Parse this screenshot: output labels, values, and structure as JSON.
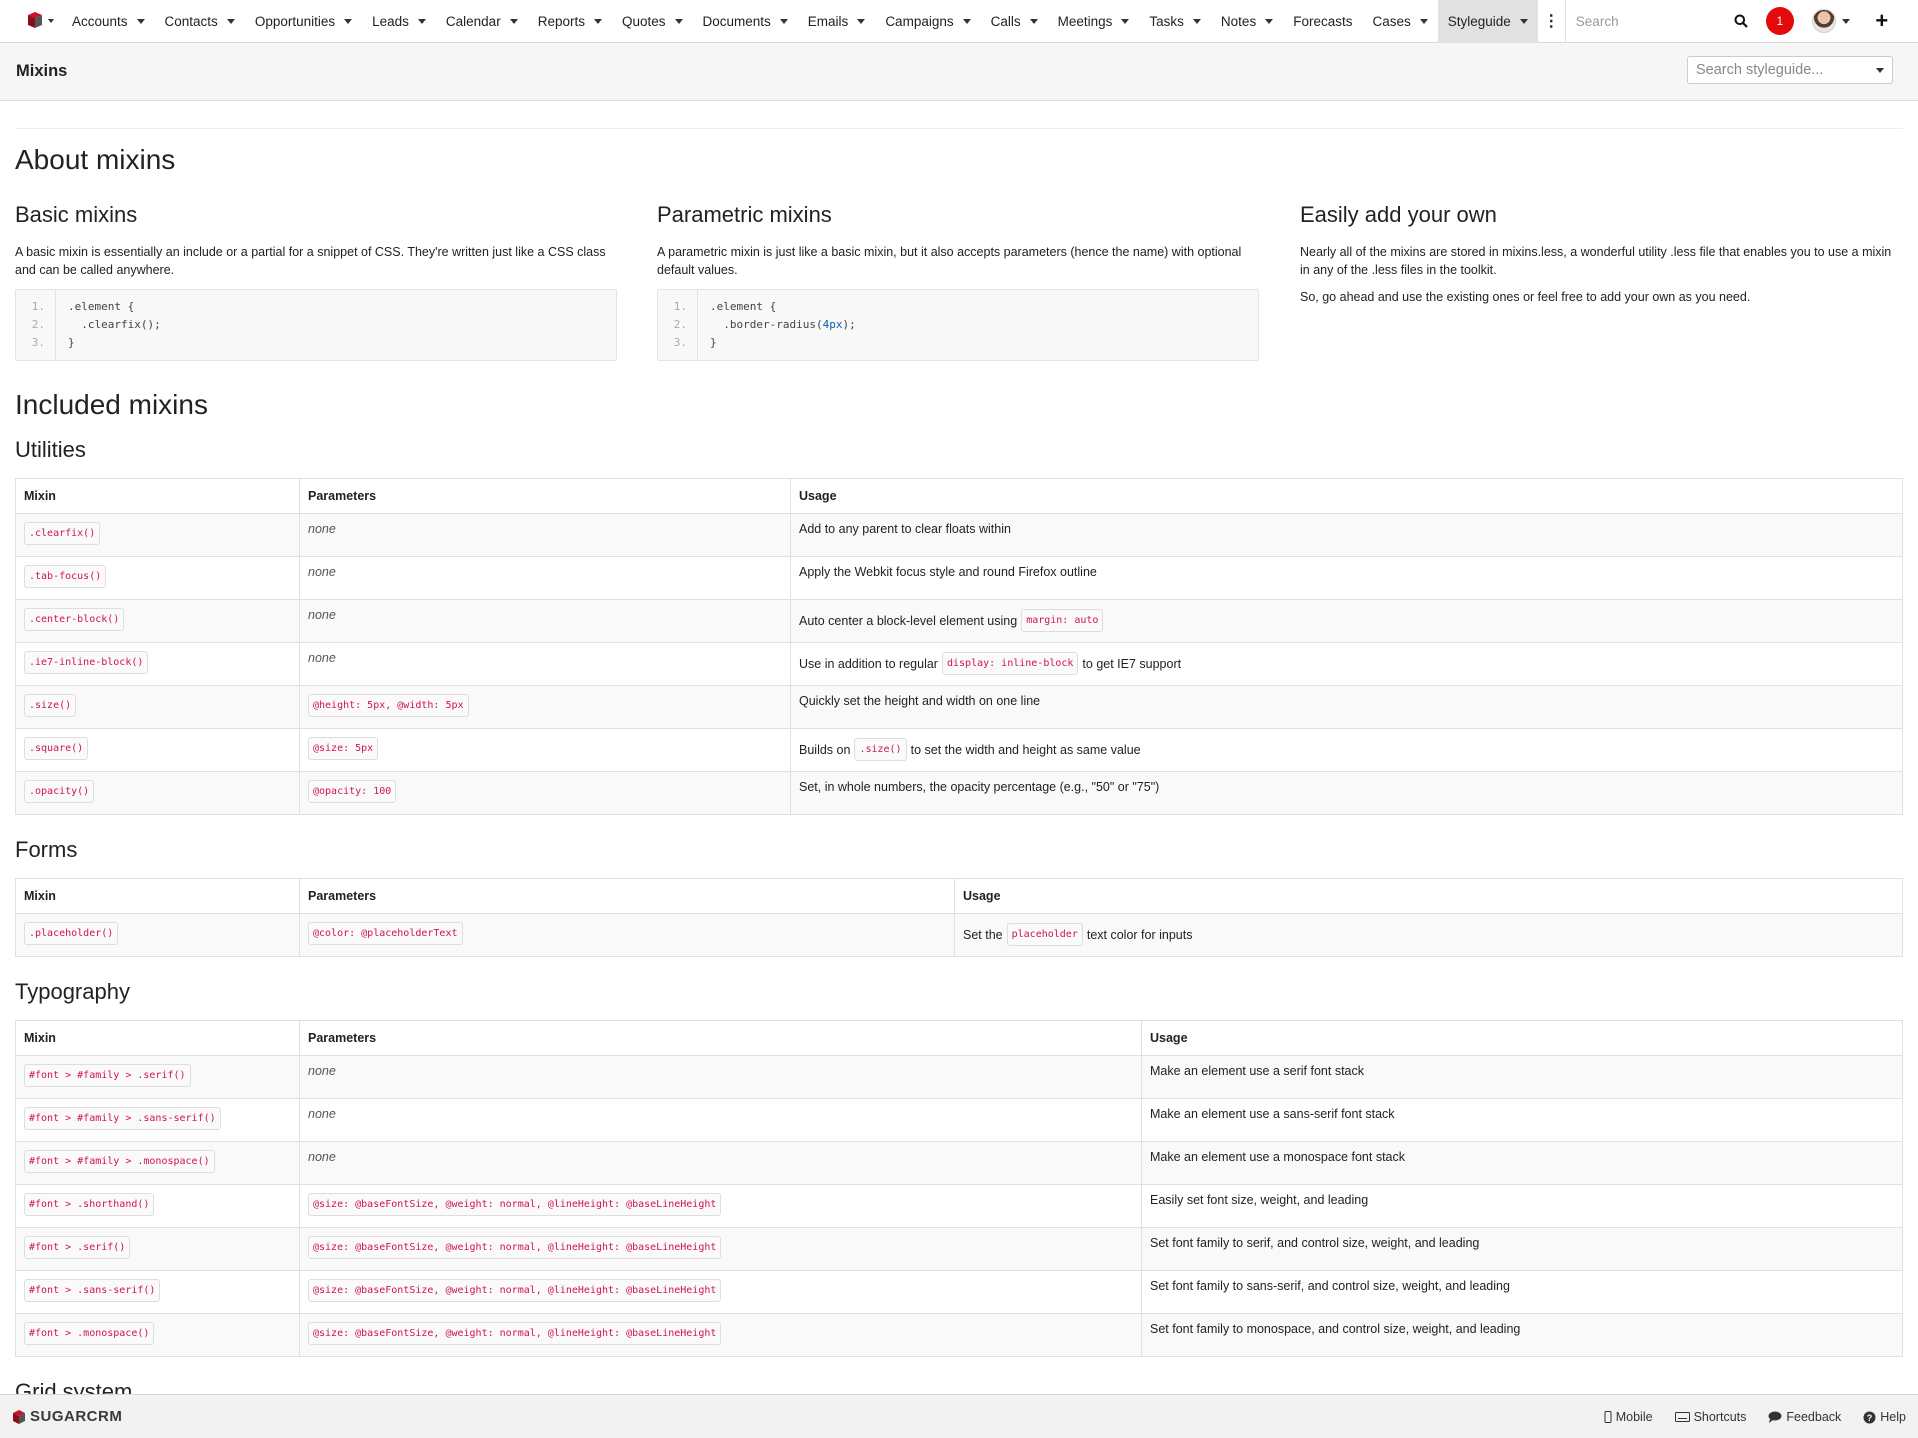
{
  "nav": {
    "items": [
      {
        "label": "Accounts",
        "caret": true
      },
      {
        "label": "Contacts",
        "caret": true
      },
      {
        "label": "Opportunities",
        "caret": true
      },
      {
        "label": "Leads",
        "caret": true
      },
      {
        "label": "Calendar",
        "caret": true
      },
      {
        "label": "Reports",
        "caret": true
      },
      {
        "label": "Quotes",
        "caret": true
      },
      {
        "label": "Documents",
        "caret": true
      },
      {
        "label": "Emails",
        "caret": true
      },
      {
        "label": "Campaigns",
        "caret": true
      },
      {
        "label": "Calls",
        "caret": true
      },
      {
        "label": "Meetings",
        "caret": true
      },
      {
        "label": "Tasks",
        "caret": true
      },
      {
        "label": "Notes",
        "caret": true
      },
      {
        "label": "Forecasts",
        "caret": false
      },
      {
        "label": "Cases",
        "caret": true
      },
      {
        "label": "Styleguide",
        "caret": true,
        "active": true
      }
    ],
    "search_placeholder": "Search",
    "notification_count": "1"
  },
  "subheader": {
    "title": "Mixins",
    "search_placeholder": "Search styleguide..."
  },
  "about": {
    "heading": "About mixins",
    "basic": {
      "title": "Basic mixins",
      "text": "A basic mixin is essentially an include or a partial for a snippet of CSS. They're written just like a CSS class and can be called anywhere.",
      "code": [
        ".element {",
        "  .clearfix();",
        "}"
      ]
    },
    "parametric": {
      "title": "Parametric mixins",
      "text": "A parametric mixin is just like a basic mixin, but it also accepts parameters (hence the name) with optional default values.",
      "code": [
        ".element {",
        "  .border-radius(",
        "4px",
        ");",
        "}"
      ]
    },
    "own": {
      "title": "Easily add your own",
      "text1": "Nearly all of the mixins are stored in mixins.less, a wonderful utility .less file that enables you to use a mixin in any of the .less files in the toolkit.",
      "text2": "So, go ahead and use the existing ones or feel free to add your own as you need."
    },
    "line_numbers": [
      "1.",
      "2.",
      "3."
    ]
  },
  "included": {
    "heading": "Included mixins",
    "columns": {
      "mixin": "Mixin",
      "parameters": "Parameters",
      "usage": "Usage"
    },
    "utilities": {
      "title": "Utilities",
      "rows": [
        {
          "mixin": ".clearfix()",
          "params": "none",
          "usage": "Add to any parent to clear floats within"
        },
        {
          "mixin": ".tab-focus()",
          "params": "none",
          "usage": "Apply the Webkit focus style and round Firefox outline"
        },
        {
          "mixin": ".center-block()",
          "params": "none",
          "usage_pre": "Auto center a block-level element using",
          "usage_code": "margin: auto",
          "usage_post": ""
        },
        {
          "mixin": ".ie7-inline-block()",
          "params": "none",
          "usage_pre": "Use in addition to regular",
          "usage_code": "display: inline-block",
          "usage_post": "to get IE7 support"
        },
        {
          "mixin": ".size()",
          "params_code": "@height: 5px, @width: 5px",
          "usage": "Quickly set the height and width on one line"
        },
        {
          "mixin": ".square()",
          "params_code": "@size: 5px",
          "usage_pre": "Builds on",
          "usage_code": ".size()",
          "usage_post": "to set the width and height as same value"
        },
        {
          "mixin": ".opacity()",
          "params_code": "@opacity: 100",
          "usage": "Set, in whole numbers, the opacity percentage (e.g., \"50\" or \"75\")"
        }
      ]
    },
    "forms": {
      "title": "Forms",
      "rows": [
        {
          "mixin": ".placeholder()",
          "params_code": "@color: @placeholderText",
          "usage_pre": "Set the",
          "usage_code": "placeholder",
          "usage_post": "text color for inputs"
        }
      ]
    },
    "typography": {
      "title": "Typography",
      "rows": [
        {
          "mixin": "#font > #family > .serif()",
          "params": "none",
          "usage": "Make an element use a serif font stack"
        },
        {
          "mixin": "#font > #family > .sans-serif()",
          "params": "none",
          "usage": "Make an element use a sans-serif font stack"
        },
        {
          "mixin": "#font > #family > .monospace()",
          "params": "none",
          "usage": "Make an element use a monospace font stack"
        },
        {
          "mixin": "#font > .shorthand()",
          "params_code": "@size: @baseFontSize, @weight: normal, @lineHeight: @baseLineHeight",
          "usage": "Easily set font size, weight, and leading"
        },
        {
          "mixin": "#font > .serif()",
          "params_code": "@size: @baseFontSize, @weight: normal, @lineHeight: @baseLineHeight",
          "usage": "Set font family to serif, and control size, weight, and leading"
        },
        {
          "mixin": "#font > .sans-serif()",
          "params_code": "@size: @baseFontSize, @weight: normal, @lineHeight: @baseLineHeight",
          "usage": "Set font family to sans-serif, and control size, weight, and leading"
        },
        {
          "mixin": "#font > .monospace()",
          "params_code": "@size: @baseFontSize, @weight: normal, @lineHeight: @baseLineHeight",
          "usage": "Set font family to monospace, and control size, weight, and leading"
        }
      ]
    },
    "grid_title": "Grid system"
  },
  "footer": {
    "brand": "SUGARCRM",
    "links": [
      "Mobile",
      "Shortcuts",
      "Feedback",
      "Help"
    ]
  },
  "colors": {
    "code_text": "#d0115a",
    "notification_bg": "#e20a0a",
    "active_tab_bg": "#e1e1e1"
  }
}
